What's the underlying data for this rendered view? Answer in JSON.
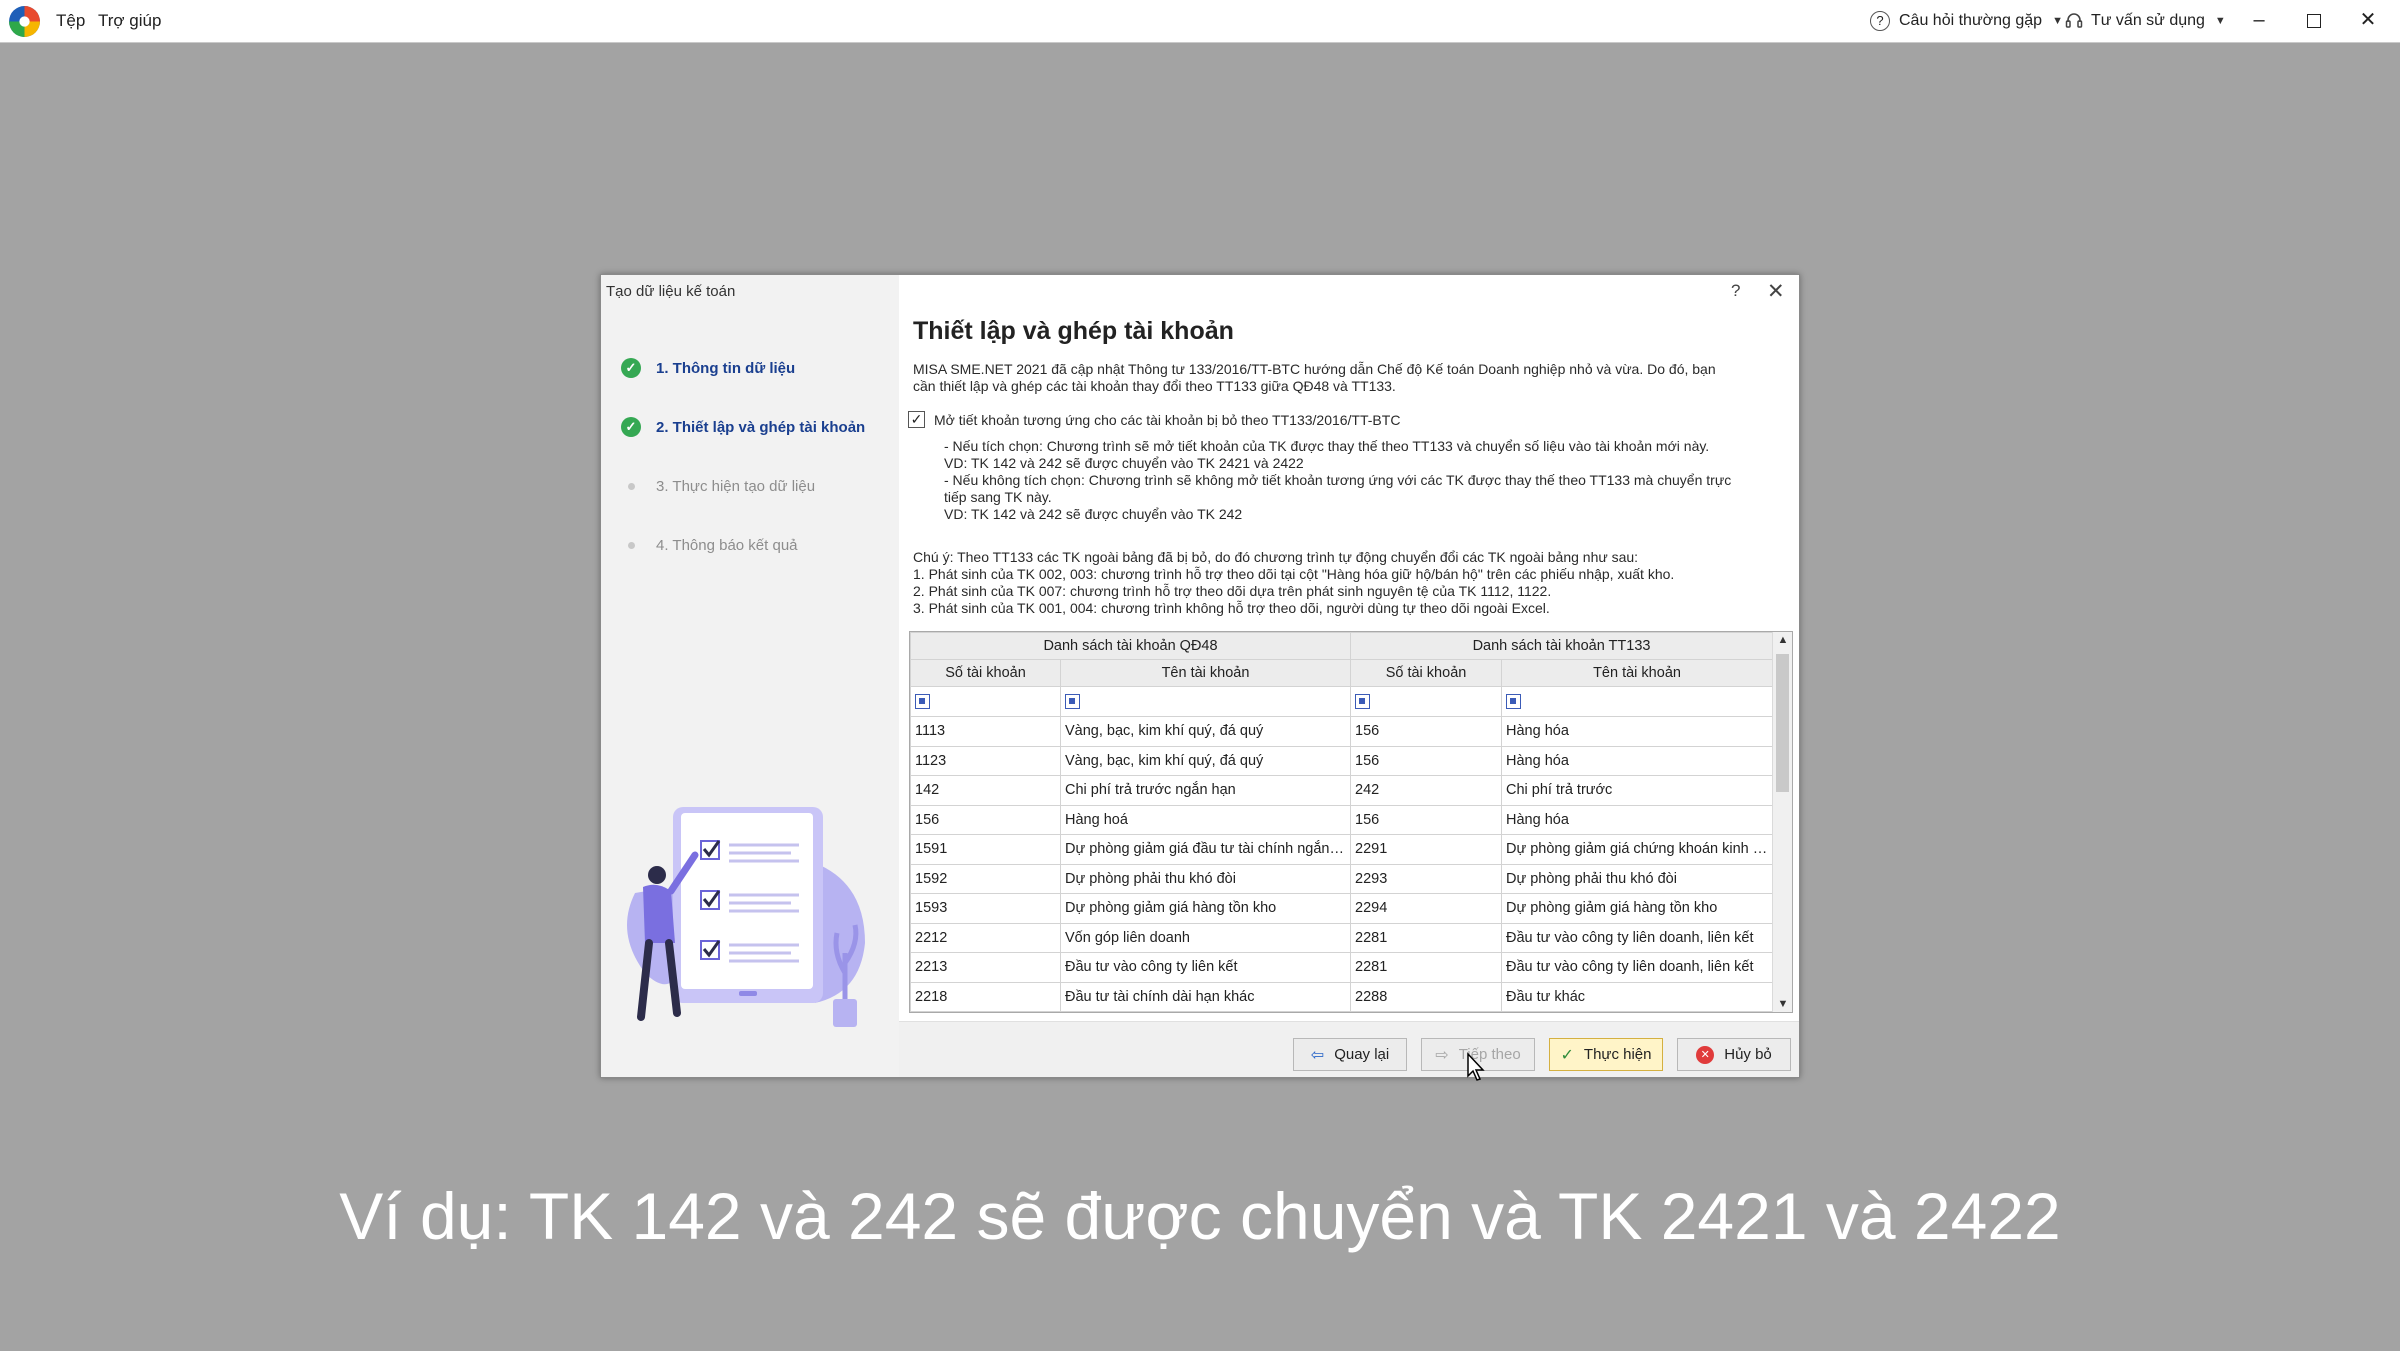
{
  "topbar": {
    "menu": [
      "Tệp",
      "Trợ giúp"
    ],
    "faq": "Câu hỏi thường gặp",
    "consult": "Tư vấn sử dụng"
  },
  "dialog": {
    "window_title": "Tạo dữ liệu kế toán",
    "steps": [
      {
        "label": "1. Thông tin dữ liệu",
        "state": "done"
      },
      {
        "label": "2. Thiết lập và ghép tài khoản",
        "state": "done"
      },
      {
        "label": "3. Thực hiện tạo dữ liệu",
        "state": "todo"
      },
      {
        "label": "4. Thông  báo kết quả",
        "state": "todo"
      }
    ],
    "title": "Thiết lập và ghép tài khoản",
    "intro_line1": "MISA SME.NET 2021 đã cập nhật Thông tư 133/2016/TT-BTC hướng dẫn Chế độ Kế toán Doanh nghiệp nhỏ và vừa. Do đó, bạn",
    "intro_line2": "cần thiết lập và ghép các tài khoản thay đổi theo TT133 giữa QĐ48 và TT133.",
    "checkbox_label": "Mở tiết khoản tương ứng cho các tài khoản bị bỏ theo TT133/2016/TT-BTC",
    "checkbox_checked": true,
    "option_lines": [
      "- Nếu tích chọn: Chương trình sẽ mở tiết khoản của TK được thay thế theo TT133 và chuyển số liệu vào tài khoản mới này.",
      "VD: TK 142 và 242 sẽ được chuyển vào TK 2421 và 2422",
      "- Nếu không tích chọn: Chương trình sẽ không mở tiết khoản tương ứng với các TK được thay thế theo TT133 mà chuyển trực",
      "tiếp sang TK này.",
      "VD: TK 142 và 242 sẽ được chuyển vào TK 242"
    ],
    "note_lines": [
      "Chú ý: Theo TT133 các TK ngoài bảng đã bị bỏ, do đó chương trình tự động chuyển đổi các TK ngoài bảng như sau:",
      "1. Phát sinh của TK 002, 003: chương trình hỗ trợ theo dõi tại cột \"Hàng hóa giữ hộ/bán hộ\" trên các phiếu nhập, xuất kho.",
      "2. Phát sinh của TK 007: chương trình hỗ trợ theo dõi dựa trên phát sinh nguyên tệ của TK 1112, 1122.",
      "3. Phát sinh của TK 001, 004: chương trình không hỗ trợ theo dõi, người dùng tự theo dõi ngoài Excel."
    ],
    "grid": {
      "group_left": "Danh sách tài khoản QĐ48",
      "group_right": "Danh sách tài khoản TT133",
      "col_no": "Số tài khoản",
      "col_name": "Tên tài khoản",
      "rows": [
        [
          "1113",
          "Vàng, bạc, kim khí quý, đá quý",
          "156",
          "Hàng hóa"
        ],
        [
          "1123",
          "Vàng, bạc, kim khí quý, đá quý",
          "156",
          "Hàng hóa"
        ],
        [
          "142",
          "Chi phí trả trước ngắn hạn",
          "242",
          "Chi phí trả trước"
        ],
        [
          "156",
          "Hàng hoá",
          "156",
          "Hàng hóa"
        ],
        [
          "1591",
          "Dự phòng giảm giá đầu tư tài chính ngắn hạn",
          "2291",
          "Dự phòng giảm giá chứng khoán kinh doanh"
        ],
        [
          "1592",
          "Dự phòng phải thu khó đòi",
          "2293",
          "Dự phòng phải thu khó đòi"
        ],
        [
          "1593",
          "Dự phòng giảm giá hàng tồn kho",
          "2294",
          "Dự phòng giảm giá hàng tồn kho"
        ],
        [
          "2212",
          "Vốn góp liên doanh",
          "2281",
          "Đầu tư vào công ty liên doanh, liên kết"
        ],
        [
          "2213",
          "Đầu tư vào công ty liên kết",
          "2281",
          "Đầu tư vào công ty liên doanh, liên kết"
        ],
        [
          "2218",
          "Đầu tư tài chính dài hạn khác",
          "2288",
          "Đầu tư khác"
        ]
      ]
    },
    "buttons": {
      "back": "Quay lại",
      "next": "Tiếp theo",
      "execute": "Thực hiện",
      "cancel": "Hủy bỏ"
    }
  },
  "caption": "Ví dụ: TK 142 và 242 sẽ được chuyển và TK 2421 và 2422",
  "colors": {
    "accent_blue": "#1a3f8f",
    "step_done": "#35a853",
    "backdrop": "#a3a3a3"
  }
}
